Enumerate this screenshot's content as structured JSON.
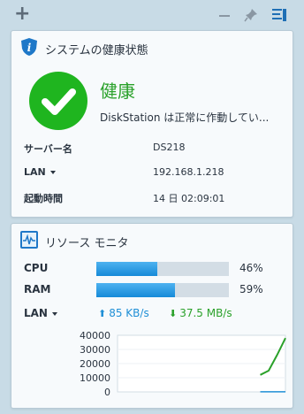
{
  "topbar": {
    "add_icon": "plus-icon",
    "minimize_icon": "minus-icon",
    "pin_icon": "pin-icon",
    "menu_icon": "widget-menu-icon"
  },
  "health": {
    "title": "システムの健康状態",
    "status": "健康",
    "message": "DiskStation は正常に作動してい...",
    "rows": [
      {
        "label": "サーバー名",
        "value": "DS218"
      },
      {
        "label": "LAN",
        "value": "192.168.1.218"
      },
      {
        "label": "起動時間",
        "value": "14 日 02:09:01"
      }
    ],
    "status_color": "#1fb51f"
  },
  "monitor": {
    "title": "リソース モニタ",
    "cpu": {
      "label": "CPU",
      "percent_text": "46%",
      "percent": 46
    },
    "ram": {
      "label": "RAM",
      "percent_text": "59%",
      "percent": 59
    },
    "lan": {
      "label": "LAN",
      "upload": "85 KB/s",
      "download": "37.5 MB/s"
    },
    "colors": {
      "bar": "#168ad8",
      "upload": "#1f8fd6",
      "download": "#2aa12a"
    }
  },
  "chart_data": {
    "type": "line",
    "ylim": [
      0,
      40000
    ],
    "yticks": [
      "40000",
      "30000",
      "20000",
      "10000",
      "0"
    ],
    "series": [
      {
        "values": [
          0,
          0,
          0,
          0,
          0,
          0,
          0,
          0,
          0,
          0,
          0,
          0,
          0,
          0,
          0,
          0,
          0,
          12000,
          15000,
          26000,
          38000
        ]
      },
      {
        "values": [
          0,
          0,
          0,
          0,
          0,
          0,
          0,
          0,
          0,
          0,
          0,
          0,
          0,
          0,
          0,
          0,
          0,
          85,
          85,
          85,
          85
        ]
      }
    ],
    "grid": true
  }
}
